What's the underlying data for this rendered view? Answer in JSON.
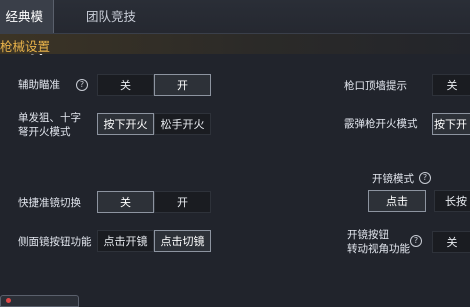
{
  "tabs": {
    "classic": "经典模式",
    "team": "团队竞技"
  },
  "section_title": "枪械设置",
  "rows": {
    "aim_assist": {
      "label": "辅助瞄准",
      "off": "关",
      "on": "开"
    },
    "muzzle_hint": {
      "label": "枪口顶墙提示",
      "off": "关"
    },
    "sniper_fire": {
      "label_line1": "单发狙、十字",
      "label_line2": "弩开火模式",
      "opt1": "按下开火",
      "opt2": "松手开火"
    },
    "shotgun_fire": {
      "label": "霰弹枪开火模式",
      "opt1": "按下开"
    },
    "scope_mode": {
      "label": "开镜模式",
      "opt1": "点击",
      "opt2": "长按"
    },
    "quick_scope": {
      "label": "快捷准镜切换",
      "off": "关",
      "on": "开"
    },
    "side_scope": {
      "label": "侧面镜按钮功能",
      "opt1": "点击开镜",
      "opt2": "点击切镜"
    },
    "scope_turn": {
      "label_line1": "开镜按钮",
      "label_line2": "转动视角功能",
      "off": "关"
    }
  },
  "help_glyph": "?"
}
